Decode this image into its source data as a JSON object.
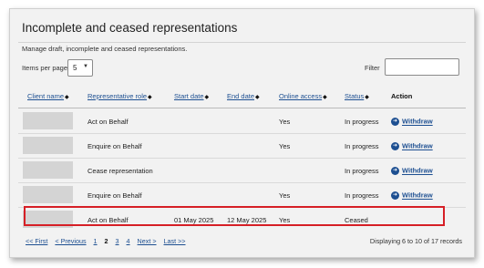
{
  "panel": {
    "title": "Incomplete and ceased representations",
    "subtitle": "Manage draft, incomplete and ceased representations."
  },
  "controls": {
    "items_per_page_label": "Items per page",
    "items_per_page_value": "5",
    "filter_label": "Filter",
    "filter_value": ""
  },
  "table": {
    "headers": {
      "client_name": "Client name",
      "representative_role": "Representative role",
      "start_date": "Start date",
      "end_date": "End date",
      "online_access": "Online access",
      "status": "Status",
      "action": "Action"
    },
    "rows": [
      {
        "role": "Act on Behalf",
        "start": "",
        "end": "",
        "access": "Yes",
        "status": "In progress",
        "action": "Withdraw"
      },
      {
        "role": "Enquire on Behalf",
        "start": "",
        "end": "",
        "access": "Yes",
        "status": "In progress",
        "action": "Withdraw"
      },
      {
        "role": "Cease representation",
        "start": "",
        "end": "",
        "access": "",
        "status": "In progress",
        "action": "Withdraw"
      },
      {
        "role": "Enquire on Behalf",
        "start": "",
        "end": "",
        "access": "Yes",
        "status": "In progress",
        "action": "Withdraw"
      },
      {
        "role": "Act on Behalf",
        "start": "01 May 2025",
        "end": "12 May 2025",
        "access": "Yes",
        "status": "Ceased",
        "action": ""
      }
    ]
  },
  "pagination": {
    "first": "<< First",
    "previous": "< Previous",
    "pages": [
      "1",
      "2",
      "3",
      "4"
    ],
    "current": "2",
    "next": "Next >",
    "last": "Last >>",
    "records_text": "Displaying 6 to 10 of 17 records"
  },
  "colors": {
    "link": "#1d4f91",
    "highlight": "#d61f26",
    "panel_bg": "#f2f2f2"
  }
}
